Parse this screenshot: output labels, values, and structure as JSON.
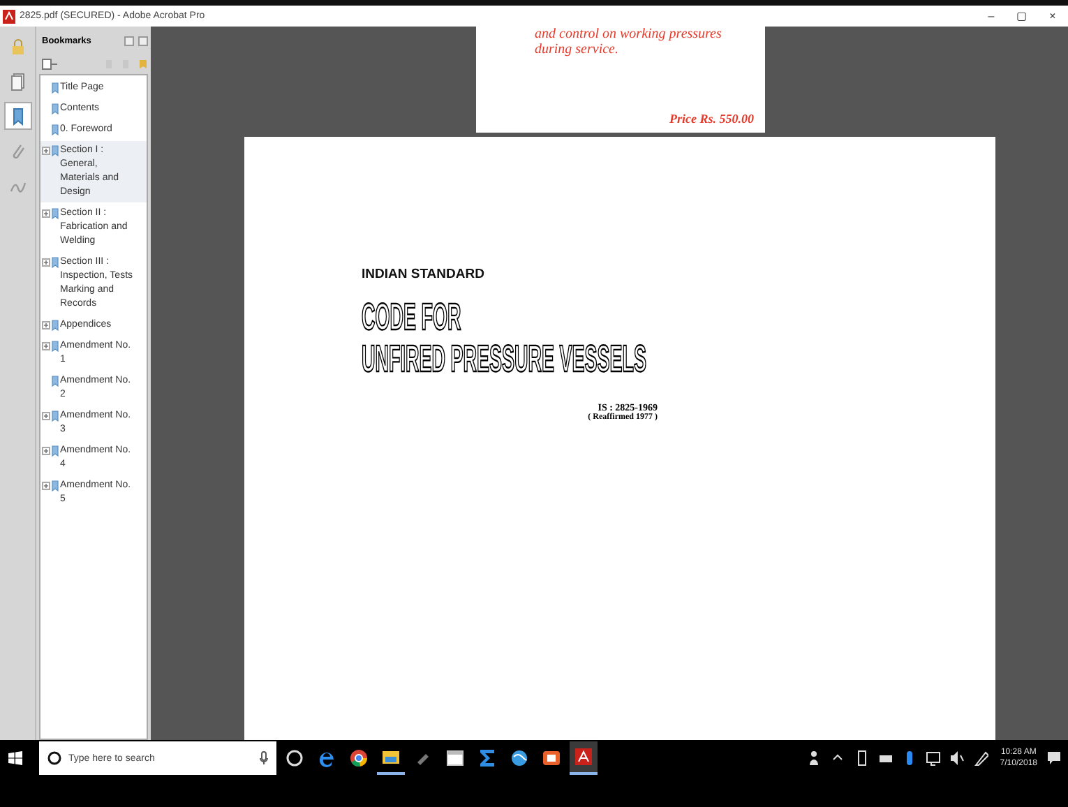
{
  "window": {
    "title": "2825.pdf (SECURED) - Adobe Acrobat Pro",
    "controls": [
      "–",
      "▢",
      "×"
    ]
  },
  "navigation": [
    {
      "kind": "lock",
      "selected": false
    },
    {
      "kind": "pages",
      "selected": false
    },
    {
      "kind": "bookmarks",
      "selected": true
    },
    {
      "kind": "attachment",
      "selected": false
    },
    {
      "kind": "signature",
      "selected": false
    }
  ],
  "bookmarks": {
    "title": "Bookmarks",
    "items": [
      {
        "label": "Title Page",
        "kind": "leaf",
        "selected": false
      },
      {
        "label": "Contents",
        "kind": "leaf",
        "selected": false
      },
      {
        "label": "0. Foreword",
        "kind": "leaf",
        "selected": false
      },
      {
        "label": "Section I : General, Materials and Design",
        "kind": "folder",
        "selected": true
      },
      {
        "label": "Section II : Fabrication and Welding",
        "kind": "folder",
        "selected": false
      },
      {
        "label": "Section III : Inspection, Tests Marking and Records",
        "kind": "folder",
        "selected": false
      },
      {
        "label": "Appendices",
        "kind": "folder",
        "selected": false
      },
      {
        "label": "Amendment No. 1",
        "kind": "folder",
        "selected": false
      },
      {
        "label": "Amendment No. 2",
        "kind": "leaf",
        "selected": false
      },
      {
        "label": "Amendment No. 3",
        "kind": "folder",
        "selected": false
      },
      {
        "label": "Amendment No. 4",
        "kind": "folder",
        "selected": false
      },
      {
        "label": "Amendment No. 5",
        "kind": "folder",
        "selected": false
      }
    ]
  },
  "previous_page": {
    "lines": [
      "and control on working pressures",
      "during service."
    ],
    "price": "Price Rs. 550.00"
  },
  "page": {
    "kicker": "INDIAN STANDARD",
    "title_lines": [
      "CODE FOR",
      "UNFIRED PRESSURE VESSELS"
    ],
    "number": "IS : 2825-1969",
    "reaffirmed": "( Reaffirmed 1977 )"
  },
  "taskbar": {
    "search_placeholder": "Type here to search",
    "apps": [
      {
        "kind": "taskview",
        "running": false
      },
      {
        "kind": "edge",
        "running": false
      },
      {
        "kind": "chrome",
        "running": false
      },
      {
        "kind": "explorer",
        "running": true
      },
      {
        "kind": "pin",
        "running": false
      },
      {
        "kind": "window",
        "running": false
      },
      {
        "kind": "sigma",
        "running": false
      },
      {
        "kind": "globe",
        "running": false
      },
      {
        "kind": "office",
        "running": false
      },
      {
        "kind": "acrobat",
        "running": true
      }
    ],
    "tray": [
      {
        "kind": "people"
      },
      {
        "kind": "caret"
      },
      {
        "kind": "battery"
      },
      {
        "kind": "keyboard"
      },
      {
        "kind": "dropbox"
      },
      {
        "kind": "network"
      },
      {
        "kind": "volume"
      },
      {
        "kind": "pen"
      }
    ],
    "time": "10:28 AM",
    "date": "7/10/2018"
  }
}
